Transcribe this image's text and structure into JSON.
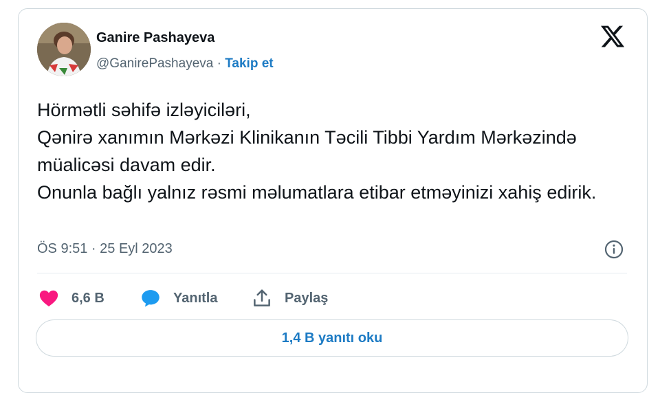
{
  "author": {
    "name": "Ganire Pashayeva",
    "handle": "@GanirePashayeva",
    "separator": " · ",
    "follow_label": "Takip et"
  },
  "tweet": {
    "text": "Hörmətli səhifə izləyiciləri,\nQənirə xanımın Mərkəzi Klinikanın Təcili Tibbi Yardım Mərkəzində müalicəsi davam edir.\nOnunla bağlı yalnız rəsmi məlumatlara etibar etməyinizi xahiş edirik.",
    "timestamp": "ÖS 9:51 · 25 Eyl 2023"
  },
  "actions": {
    "like_count": "6,6 B",
    "reply_label": "Yanıtla",
    "share_label": "Paylaş"
  },
  "replies_button": "1,4 B yanıtı oku",
  "colors": {
    "link": "#1d7bc4",
    "like": "#f91880",
    "reply": "#1d9bf0",
    "muted": "#536471"
  },
  "icons": [
    "x-logo-icon",
    "info-icon",
    "heart-icon",
    "speech-bubble-icon",
    "share-icon"
  ]
}
